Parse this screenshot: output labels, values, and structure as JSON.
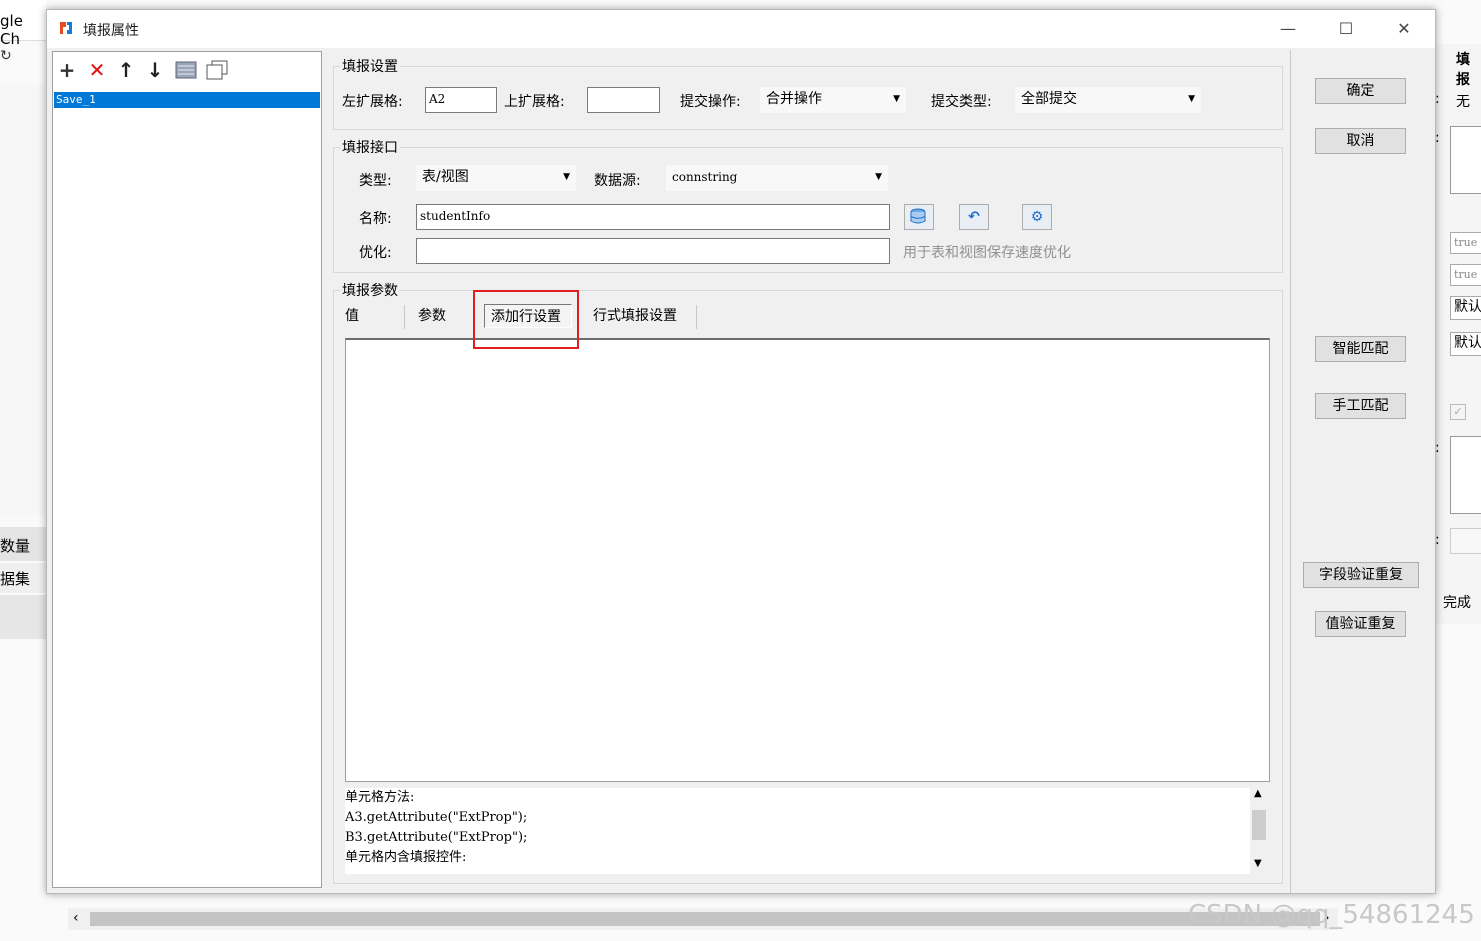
{
  "background": {
    "chrome_tab_text": "gle Ch",
    "left_items": [
      "数量",
      "据集"
    ],
    "right_panel": {
      "title": "填报",
      "value_none": "无",
      "true_values": [
        "true",
        "true"
      ],
      "default_values": [
        "默认",
        "默认"
      ],
      "complete_label": "完成"
    }
  },
  "dialog": {
    "title": "填报属性",
    "controls": {
      "minimize": "—",
      "maximize": "☐",
      "close": "✕"
    }
  },
  "left_pane": {
    "toolbar": [
      "+",
      "✕",
      "↑",
      "↓"
    ],
    "items": [
      "Save_1"
    ]
  },
  "report_settings": {
    "group_title": "填报设置",
    "left_expand_label": "左扩展格:",
    "left_expand_value": "A2",
    "up_expand_label": "上扩展格:",
    "up_expand_value": "",
    "submit_op_label": "提交操作:",
    "submit_op_value": "合并操作",
    "submit_type_label": "提交类型:",
    "submit_type_value": "全部提交"
  },
  "report_interface": {
    "group_title": "填报接口",
    "type_label": "类型:",
    "type_value": "表/视图",
    "datasource_label": "数据源:",
    "datasource_value": "connstring",
    "name_label": "名称:",
    "name_value": "studentInfo",
    "optimize_label": "优化:",
    "optimize_value": "",
    "optimize_hint": "用于表和视图保存速度优化"
  },
  "report_params": {
    "group_title": "填报参数",
    "tabs": [
      "值",
      "参数",
      "添加行设置",
      "行式填报设置"
    ],
    "active_tab": "添加行设置",
    "code_lines": [
      "单元格方法:",
      "A3.getAttribute(\"ExtProp\");",
      "B3.getAttribute(\"ExtProp\");",
      "单元格内含填报控件:"
    ]
  },
  "buttons": {
    "ok": "确定",
    "cancel": "取消",
    "smart_match": "智能匹配",
    "manual_match": "手工匹配",
    "field_validate": "字段验证重复",
    "value_validate": "值验证重复"
  },
  "watermark": "CSDN @qq_54861245",
  "colors": {
    "selection": "#0078d7",
    "highlight_box": "#e02020"
  }
}
